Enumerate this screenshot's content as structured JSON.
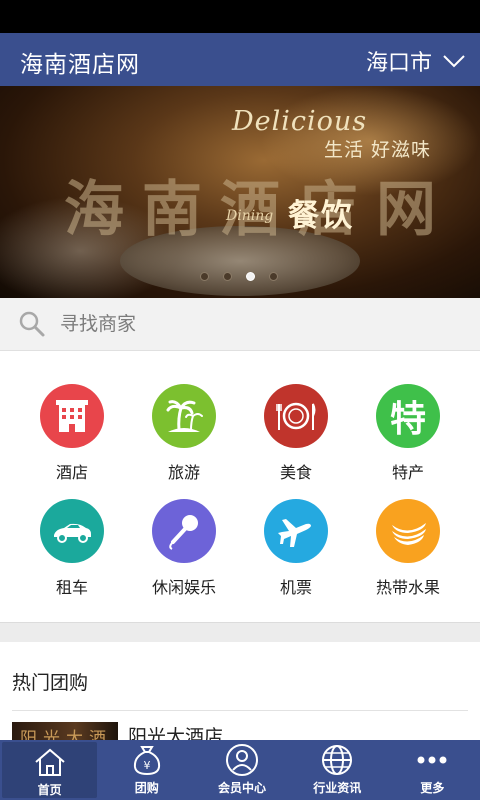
{
  "header": {
    "title": "海南酒店网",
    "city": "海口市"
  },
  "banner": {
    "text_en": "Delicious",
    "text_sub": "生活 好滋味",
    "text_big": "海南酒店网",
    "text_dining": "Dining",
    "text_canyin": "餐饮",
    "slides": 4,
    "active_slide": 3
  },
  "search": {
    "placeholder": "寻找商家"
  },
  "categories": [
    {
      "label": "酒店",
      "icon": "hotel-icon",
      "color": "#e8454b"
    },
    {
      "label": "旅游",
      "icon": "palm-tree-icon",
      "color": "#7cc02f"
    },
    {
      "label": "美食",
      "icon": "plate-cutlery-icon",
      "color": "#c0342c"
    },
    {
      "label": "特产",
      "icon": "specialty-icon",
      "color": "#3fc04a",
      "icon_text": "特"
    },
    {
      "label": "租车",
      "icon": "car-icon",
      "color": "#1ba99c"
    },
    {
      "label": "休闲娱乐",
      "icon": "microphone-icon",
      "color": "#6d63d8"
    },
    {
      "label": "机票",
      "icon": "airplane-icon",
      "color": "#25a9e0"
    },
    {
      "label": "热带水果",
      "icon": "banana-icon",
      "color": "#f9a21f"
    }
  ],
  "hot_deals": {
    "title": "热门团购",
    "items": [
      {
        "name": "阳光大酒店",
        "thumb_text": "阳光大酒"
      }
    ]
  },
  "tabbar": {
    "tabs": [
      {
        "label": "首页",
        "icon": "home-icon",
        "active": true
      },
      {
        "label": "团购",
        "icon": "money-bag-icon",
        "active": false
      },
      {
        "label": "会员中心",
        "icon": "user-icon",
        "active": false
      },
      {
        "label": "行业资讯",
        "icon": "globe-icon",
        "active": false
      },
      {
        "label": "更多",
        "icon": "more-dots-icon",
        "active": false
      }
    ]
  },
  "colors": {
    "primary": "#3a4f8e",
    "background": "#f2f2f2"
  }
}
